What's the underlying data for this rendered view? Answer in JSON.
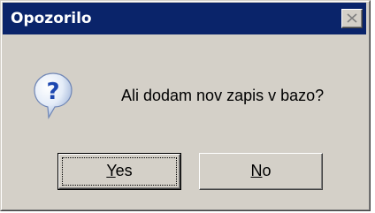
{
  "dialog": {
    "title": "Opozorilo",
    "message": "Ali dodam nov zapis v bazo?",
    "icon": "question-icon",
    "close_icon": "close-icon",
    "buttons": [
      {
        "accel": "Y",
        "rest": "es",
        "default": true
      },
      {
        "accel": "N",
        "rest": "o",
        "default": false
      }
    ]
  },
  "colors": {
    "titlebar": "#0a246a",
    "face": "#d4d0c8",
    "title_text": "#ffffff"
  }
}
